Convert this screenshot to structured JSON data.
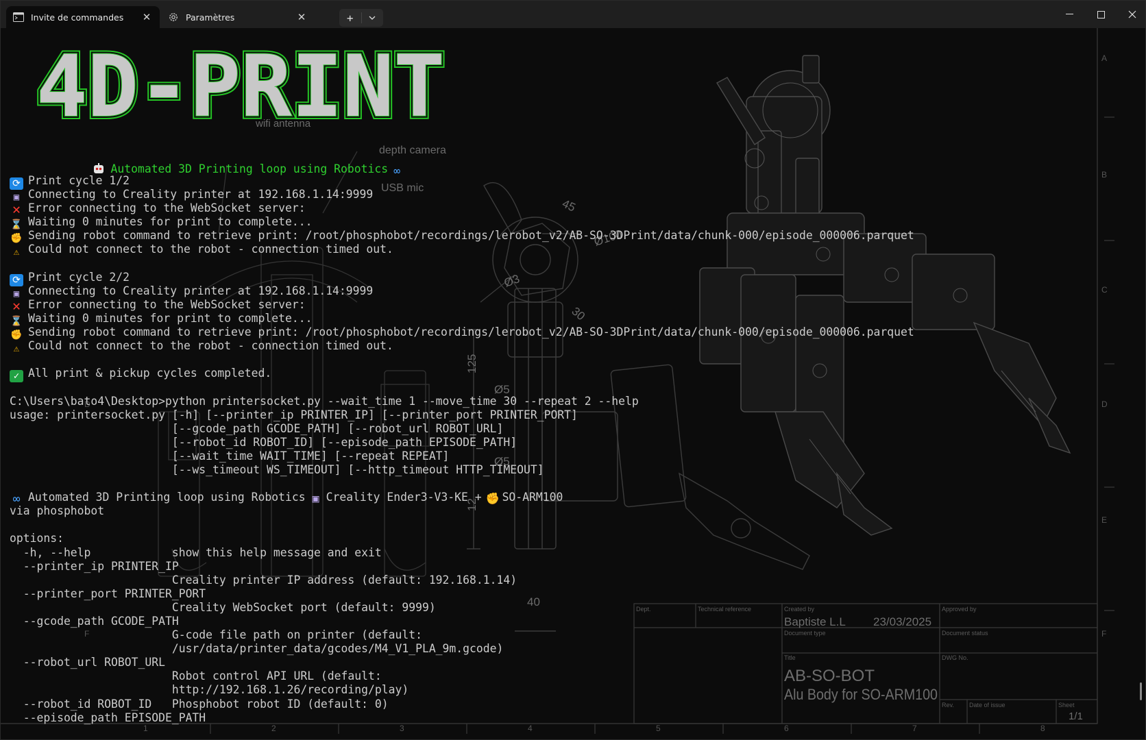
{
  "tabs": [
    {
      "label": "Invite de commandes",
      "icon": "cmd-icon",
      "active": true
    },
    {
      "label": "Paramètres",
      "icon": "gear-icon",
      "active": false
    }
  ],
  "newtab": {
    "plus": "+",
    "dropdown": "chevron-down-icon"
  },
  "window_controls": {
    "minimize": "—",
    "maximize": "☐",
    "close": "✕"
  },
  "banner": {
    "text": "4D-PRINT",
    "face_color": "#c8c8c8",
    "outline_color": "#25c425"
  },
  "subtitle": {
    "text": "Automated 3D Printing loop using Robotics"
  },
  "blueprint": {
    "annotations": [
      "wifi antenna",
      "depth camera",
      "USB mic",
      "45",
      "Ø100",
      "Ø3",
      "30",
      "125",
      "Ø5",
      "Ø5",
      "12",
      "40"
    ],
    "row_letters": [
      "A",
      "B",
      "C",
      "D",
      "E",
      "F"
    ],
    "left_letters": [
      "D",
      "F"
    ],
    "col_numbers": [
      "1",
      "2",
      "3",
      "4",
      "5",
      "6",
      "7",
      "8"
    ],
    "title_block": {
      "dept": "Dept.",
      "technical_reference": "Technical reference",
      "created_by_label": "Created by",
      "created_by": "Baptiste L.L",
      "date": "23/03/2025",
      "approved_by_label": "Approved by",
      "document_type_label": "Document type",
      "document_status_label": "Document status",
      "title_label": "Title",
      "title": "AB-SO-BOT",
      "subtitle": "Alu Body for SO-ARM100",
      "dwg_label": "DWG No.",
      "rev_label": "Rev.",
      "date_issue_label": "Date of issue",
      "sheet_label": "Sheet",
      "sheet": "1/1"
    }
  },
  "console": {
    "lines": [
      {
        "icon": "cycle",
        "text": "Print cycle 1/2"
      },
      {
        "icon": "printer",
        "text": "Connecting to Creality printer at 192.168.1.14:9999"
      },
      {
        "icon": "cross",
        "text": "Error connecting to the WebSocket server:"
      },
      {
        "icon": "hourglass",
        "text": "Waiting 0 minutes for print to complete..."
      },
      {
        "icon": "arm",
        "text": "Sending robot command to retrieve print: /root/phosphobot/recordings/lerobot_v2/AB-SO-3DPrint/data/chunk-000/episode_000006.parquet"
      },
      {
        "icon": "warn",
        "text": "Could not connect to the robot - connection timed out."
      },
      {
        "icon": "",
        "text": ""
      },
      {
        "icon": "cycle",
        "text": "Print cycle 2/2"
      },
      {
        "icon": "printer",
        "text": "Connecting to Creality printer at 192.168.1.14:9999"
      },
      {
        "icon": "cross",
        "text": "Error connecting to the WebSocket server:"
      },
      {
        "icon": "hourglass",
        "text": "Waiting 0 minutes for print to complete..."
      },
      {
        "icon": "arm",
        "text": "Sending robot command to retrieve print: /root/phosphobot/recordings/lerobot_v2/AB-SO-3DPrint/data/chunk-000/episode_000006.parquet"
      },
      {
        "icon": "warn",
        "text": "Could not connect to the robot - connection timed out."
      },
      {
        "icon": "",
        "text": ""
      },
      {
        "icon": "check",
        "text": "All print & pickup cycles completed."
      },
      {
        "icon": "",
        "text": ""
      },
      {
        "icon": "",
        "text": "C:\\Users\\bato4\\Desktop>python printersocket.py --wait_time 1 --move_time 30 --repeat 2 --help"
      },
      {
        "icon": "",
        "text": "usage: printersocket.py [-h] [--printer_ip PRINTER_IP] [--printer_port PRINTER_PORT]"
      },
      {
        "icon": "",
        "text": "                        [--gcode_path GCODE_PATH] [--robot_url ROBOT_URL]"
      },
      {
        "icon": "",
        "text": "                        [--robot_id ROBOT_ID] [--episode_path EPISODE_PATH]"
      },
      {
        "icon": "",
        "text": "                        [--wait_time WAIT_TIME] [--repeat REPEAT]"
      },
      {
        "icon": "",
        "text": "                        [--ws_timeout WS_TIMEOUT] [--http_timeout HTTP_TIMEOUT]"
      },
      {
        "icon": "",
        "text": ""
      },
      {
        "icon": "",
        "text": "",
        "rich": "desc"
      },
      {
        "icon": "",
        "text": "via phosphobot"
      },
      {
        "icon": "",
        "text": ""
      },
      {
        "icon": "",
        "text": "options:"
      },
      {
        "icon": "",
        "text": "  -h, --help            show this help message and exit"
      },
      {
        "icon": "",
        "text": "  --printer_ip PRINTER_IP"
      },
      {
        "icon": "",
        "text": "                        Creality printer IP address (default: 192.168.1.14)"
      },
      {
        "icon": "",
        "text": "  --printer_port PRINTER_PORT"
      },
      {
        "icon": "",
        "text": "                        Creality WebSocket port (default: 9999)"
      },
      {
        "icon": "",
        "text": "  --gcode_path GCODE_PATH"
      },
      {
        "icon": "",
        "text": "                        G-code file path on printer (default:"
      },
      {
        "icon": "",
        "text": "                        /usr/data/printer_data/gcodes/M4_V1_PLA_9m.gcode)"
      },
      {
        "icon": "",
        "text": "  --robot_url ROBOT_URL"
      },
      {
        "icon": "",
        "text": "                        Robot control API URL (default:"
      },
      {
        "icon": "",
        "text": "                        http://192.168.1.26/recording/play)"
      },
      {
        "icon": "",
        "text": "  --robot_id ROBOT_ID   Phosphobot robot ID (default: 0)"
      },
      {
        "icon": "",
        "text": "  --episode_path EPISODE_PATH"
      }
    ],
    "desc": {
      "part1": "Automated 3D Printing loop using Robotics",
      "part2": "Creality Ender3-V3-KE +",
      "part3": "SO-ARM100"
    }
  }
}
